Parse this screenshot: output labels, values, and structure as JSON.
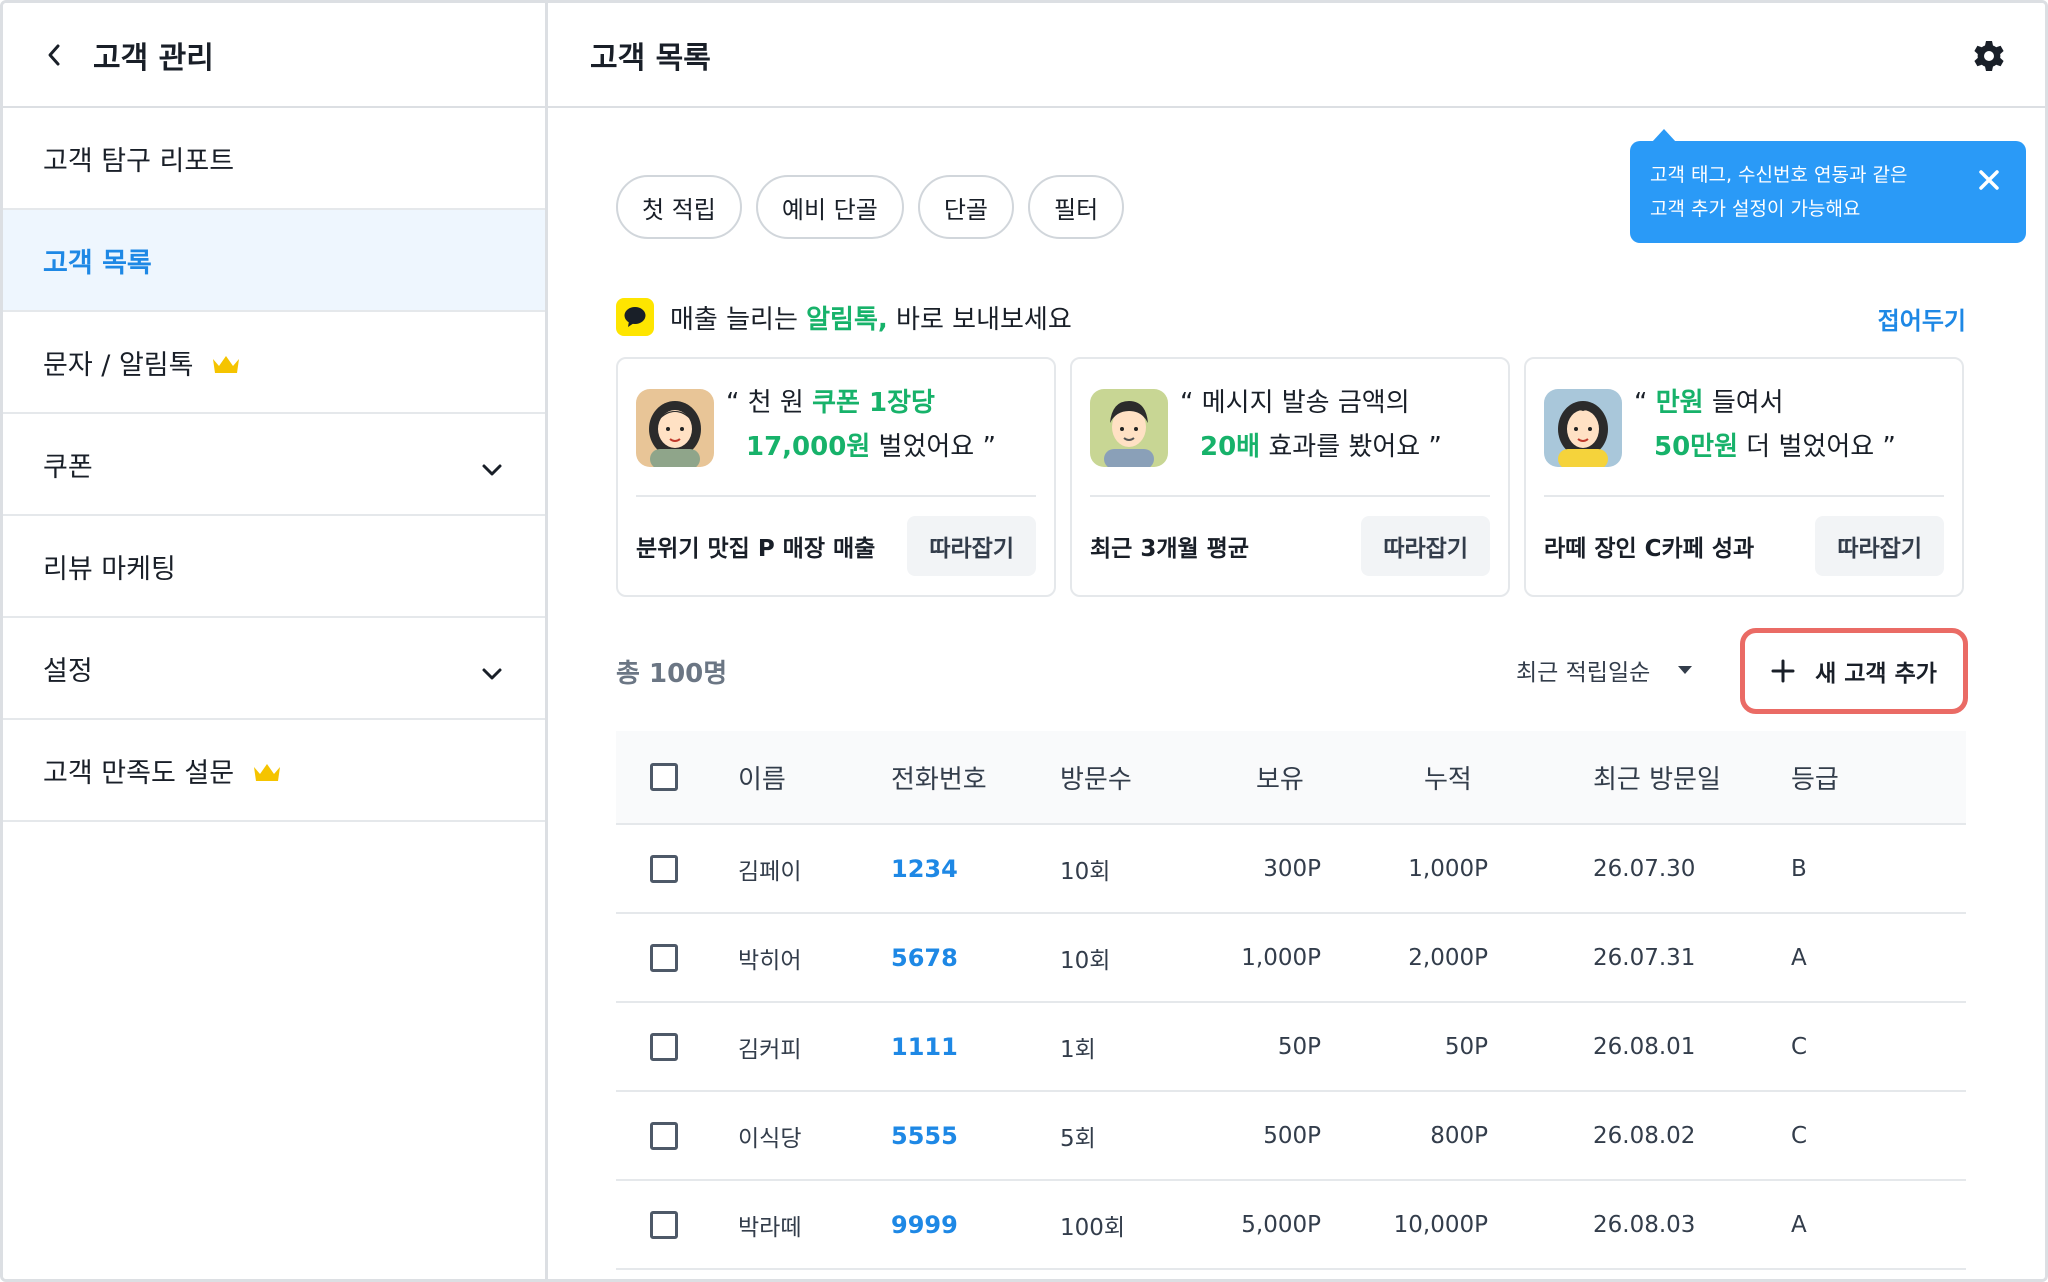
{
  "sidebar": {
    "title": "고객 관리",
    "items": [
      {
        "label": "고객 탐구 리포트"
      },
      {
        "label": "고객 목록"
      },
      {
        "label": "문자 / 알림톡"
      },
      {
        "label": "쿠폰"
      },
      {
        "label": "리뷰 마케팅"
      },
      {
        "label": "설정"
      },
      {
        "label": "고객 만족도 설문"
      }
    ]
  },
  "header": {
    "title": "고객 목록"
  },
  "tooltip": {
    "line1": "고객 태그, 수신번호 연동과 같은",
    "line2": "고객 추가 설정이 가능해요"
  },
  "chips": [
    "첫 적립",
    "예비 단골",
    "단골",
    "필터"
  ],
  "promo": {
    "prefix": "매출 늘리는 ",
    "highlight": "알림톡,",
    "suffix": " 바로 보내보세요",
    "fold_label": "접어두기",
    "follow_label": "따라잡기",
    "cards": [
      {
        "q1a": "“ 천 원 ",
        "q1b": "쿠폰 1장당",
        "q1c": "",
        "q2a": "17,000원",
        "q2b": " 벌었어요 ”",
        "caption": "분위기 맛집 P 매장 매출"
      },
      {
        "q1a": "“ 메시지 발송 금액의",
        "q1b": "",
        "q1c": "",
        "q2a": "20배",
        "q2b": " 효과를 봤어요  ”",
        "caption": "최근 3개월 평균"
      },
      {
        "q1a": "“ ",
        "q1b": "만원",
        "q1c": " 들여서",
        "q2a": "50만원",
        "q2b": " 더 벌었어요 ”",
        "caption": "라떼 장인 C카페 성과"
      }
    ]
  },
  "list": {
    "total": "총 100명",
    "sort": "최근 적립일순",
    "add_label": "새 고객 추가"
  },
  "table": {
    "headers": {
      "name": "이름",
      "phone": "전화번호",
      "visits": "방문수",
      "hold": "보유",
      "accum": "누적",
      "recent": "최근 방문일",
      "grade": "등급"
    },
    "rows": [
      {
        "name": "김페이",
        "phone": "1234",
        "visits": "10회",
        "hold": "300P",
        "accum": "1,000P",
        "recent": "26.07.30",
        "grade": "B"
      },
      {
        "name": "박히어",
        "phone": "5678",
        "visits": "10회",
        "hold": "1,000P",
        "accum": "2,000P",
        "recent": "26.07.31",
        "grade": "A"
      },
      {
        "name": "김커피",
        "phone": "1111",
        "visits": "1회",
        "hold": "50P",
        "accum": "50P",
        "recent": "26.08.01",
        "grade": "C"
      },
      {
        "name": "이식당",
        "phone": "5555",
        "visits": "5회",
        "hold": "500P",
        "accum": "800P",
        "recent": "26.08.02",
        "grade": "C"
      },
      {
        "name": "박라떼",
        "phone": "9999",
        "visits": "100회",
        "hold": "5,000P",
        "accum": "10,000P",
        "recent": "26.08.03",
        "grade": "A"
      }
    ]
  },
  "colors": {
    "accent": "#1e88e5",
    "highlight_green": "#17b26a",
    "tooltip_bg": "#2a9af7",
    "add_button_outline": "#ea6b65",
    "kakao_yellow": "#fee500",
    "active_bg": "#eef6fe"
  }
}
